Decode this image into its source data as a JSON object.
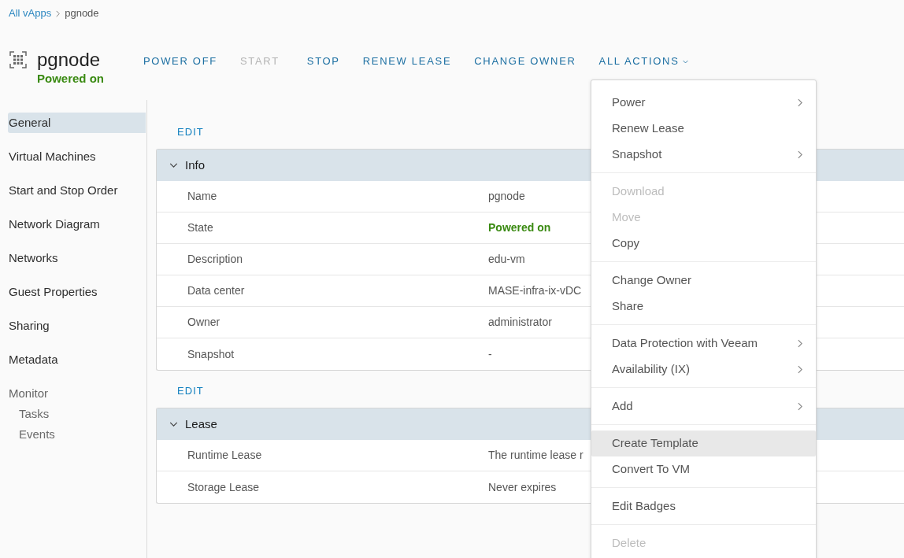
{
  "breadcrumb": {
    "items": [
      {
        "label": "All vApps",
        "kind": "link"
      },
      {
        "label": "pgnode",
        "kind": "current"
      }
    ]
  },
  "header": {
    "title": "pgnode",
    "status": "Powered on"
  },
  "actions": [
    {
      "label": "POWER OFF",
      "kind": "button",
      "disabled": false
    },
    {
      "label": "START",
      "kind": "button",
      "disabled": true
    },
    {
      "label": "STOP",
      "kind": "button",
      "disabled": false
    },
    {
      "label": "RENEW LEASE",
      "kind": "button",
      "disabled": false
    },
    {
      "label": "CHANGE OWNER",
      "kind": "button",
      "disabled": false
    },
    {
      "label": "ALL ACTIONS",
      "kind": "dropdown",
      "disabled": false
    }
  ],
  "sidebar": {
    "items": [
      {
        "label": "General",
        "selected": true
      },
      {
        "label": "Virtual Machines",
        "selected": false
      },
      {
        "label": "Start and Stop Order",
        "selected": false
      },
      {
        "label": "Network Diagram",
        "selected": false
      },
      {
        "label": "Networks",
        "selected": false
      },
      {
        "label": "Guest Properties",
        "selected": false
      },
      {
        "label": "Sharing",
        "selected": false
      },
      {
        "label": "Metadata",
        "selected": false
      },
      {
        "label": "Monitor",
        "selected": false,
        "children": [
          {
            "label": "Tasks",
            "selected": false
          },
          {
            "label": "Events",
            "selected": false
          }
        ]
      }
    ]
  },
  "sections": [
    {
      "edit_label": "EDIT",
      "title": "Info",
      "expanded": true,
      "rows": [
        {
          "label": "Name",
          "value": "pgnode",
          "kind": "text"
        },
        {
          "label": "State",
          "value": "Powered on",
          "kind": "status"
        },
        {
          "label": "Description",
          "value": "edu-vm",
          "kind": "text"
        },
        {
          "label": "Data center",
          "value": "MASE-infra-ix-vDC",
          "kind": "text"
        },
        {
          "label": "Owner",
          "value": "administrator",
          "kind": "text"
        },
        {
          "label": "Snapshot",
          "value": "-",
          "kind": "text"
        }
      ]
    },
    {
      "edit_label": "EDIT",
      "title": "Lease",
      "expanded": true,
      "rows": [
        {
          "label": "Runtime Lease",
          "value": "The runtime lease r",
          "kind": "text"
        },
        {
          "label": "Storage Lease",
          "value": "Never expires",
          "kind": "text"
        }
      ]
    }
  ],
  "actions_menu": {
    "groups": [
      {
        "items": [
          {
            "label": "Power",
            "submenu": true,
            "disabled": false,
            "highlighted": false
          },
          {
            "label": "Renew Lease",
            "submenu": false,
            "disabled": false,
            "highlighted": false
          },
          {
            "label": "Snapshot",
            "submenu": true,
            "disabled": false,
            "highlighted": false
          }
        ]
      },
      {
        "items": [
          {
            "label": "Download",
            "submenu": false,
            "disabled": true,
            "highlighted": false
          },
          {
            "label": "Move",
            "submenu": false,
            "disabled": true,
            "highlighted": false
          },
          {
            "label": "Copy",
            "submenu": false,
            "disabled": false,
            "highlighted": false
          }
        ]
      },
      {
        "items": [
          {
            "label": "Change Owner",
            "submenu": false,
            "disabled": false,
            "highlighted": false
          },
          {
            "label": "Share",
            "submenu": false,
            "disabled": false,
            "highlighted": false
          }
        ]
      },
      {
        "items": [
          {
            "label": "Data Protection with Veeam",
            "submenu": true,
            "disabled": false,
            "highlighted": false
          },
          {
            "label": "Availability (IX)",
            "submenu": true,
            "disabled": false,
            "highlighted": false
          }
        ]
      },
      {
        "items": [
          {
            "label": "Add",
            "submenu": true,
            "disabled": false,
            "highlighted": false
          }
        ]
      },
      {
        "items": [
          {
            "label": "Create Template",
            "submenu": false,
            "disabled": false,
            "highlighted": true
          },
          {
            "label": "Convert To VM",
            "submenu": false,
            "disabled": false,
            "highlighted": false
          }
        ]
      },
      {
        "items": [
          {
            "label": "Edit Badges",
            "submenu": false,
            "disabled": false,
            "highlighted": false
          }
        ]
      },
      {
        "items": [
          {
            "label": "Delete",
            "submenu": false,
            "disabled": true,
            "highlighted": false
          }
        ]
      }
    ]
  }
}
